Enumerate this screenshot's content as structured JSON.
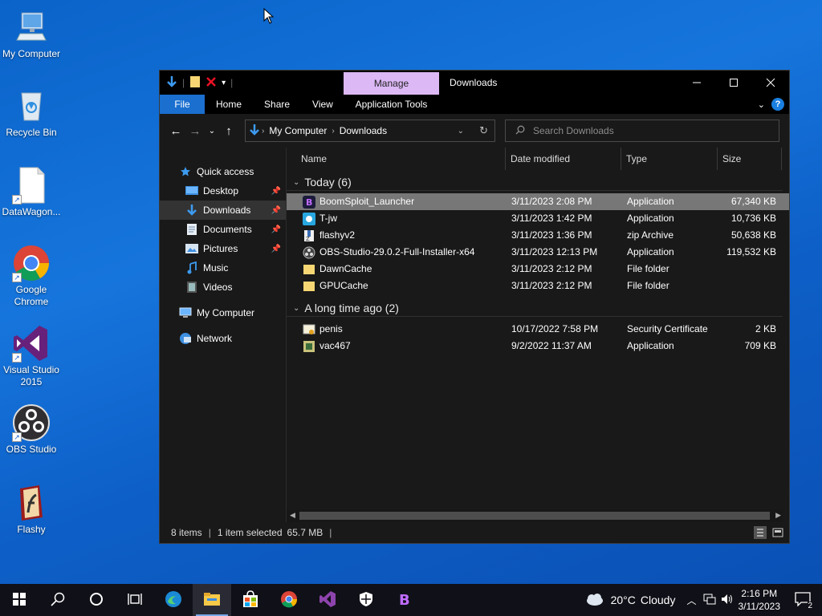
{
  "desktop": {
    "icons": [
      {
        "label": "My Computer",
        "icon": "computer-icon"
      },
      {
        "label": "Recycle Bin",
        "icon": "recycle-bin-icon"
      },
      {
        "label": "DataWagon...",
        "icon": "file-icon"
      },
      {
        "label": "Google Chrome",
        "icon": "chrome-icon"
      },
      {
        "label": "Visual Studio 2015",
        "icon": "visual-studio-icon"
      },
      {
        "label": "OBS Studio",
        "icon": "obs-icon"
      },
      {
        "label": "Flashy",
        "icon": "flashy-icon"
      }
    ]
  },
  "window": {
    "title": "Downloads",
    "manage_label": "Manage",
    "ribbon_tabs": [
      "File",
      "Home",
      "Share",
      "View"
    ],
    "app_tools_label": "Application Tools",
    "breadcrumb": [
      "My Computer",
      "Downloads"
    ],
    "search_placeholder": "Search Downloads",
    "nav": {
      "quick_access": "Quick access",
      "items": [
        {
          "label": "Desktop",
          "icon": "desktop-folder-icon",
          "pinned": true
        },
        {
          "label": "Downloads",
          "icon": "downloads-folder-icon",
          "pinned": true,
          "selected": true
        },
        {
          "label": "Documents",
          "icon": "documents-folder-icon",
          "pinned": true
        },
        {
          "label": "Pictures",
          "icon": "pictures-folder-icon",
          "pinned": true
        },
        {
          "label": "Music",
          "icon": "music-folder-icon",
          "pinned": false
        },
        {
          "label": "Videos",
          "icon": "videos-folder-icon",
          "pinned": false
        }
      ],
      "my_computer": "My Computer",
      "network": "Network"
    },
    "columns": [
      "Name",
      "Date modified",
      "Type",
      "Size"
    ],
    "groups": [
      {
        "title": "Today (6)",
        "rows": [
          {
            "name": "BoomSploit_Launcher",
            "date": "3/11/2023 2:08 PM",
            "type": "Application",
            "size": "67,340 KB",
            "icon": "boomsploit-app-icon",
            "selected": true
          },
          {
            "name": "T-jw",
            "date": "3/11/2023 1:42 PM",
            "type": "Application",
            "size": "10,736 KB",
            "icon": "tjw-app-icon"
          },
          {
            "name": "flashyv2",
            "date": "3/11/2023 1:36 PM",
            "type": "zip Archive",
            "size": "50,638 KB",
            "icon": "zip-icon"
          },
          {
            "name": "OBS-Studio-29.0.2-Full-Installer-x64",
            "date": "3/11/2023 12:13 PM",
            "type": "Application",
            "size": "119,532 KB",
            "icon": "obs-installer-icon"
          },
          {
            "name": "DawnCache",
            "date": "3/11/2023 2:12 PM",
            "type": "File folder",
            "size": "",
            "icon": "folder-icon"
          },
          {
            "name": "GPUCache",
            "date": "3/11/2023 2:12 PM",
            "type": "File folder",
            "size": "",
            "icon": "folder-icon"
          }
        ]
      },
      {
        "title": "A long time ago (2)",
        "rows": [
          {
            "name": "penis",
            "date": "10/17/2022 7:58 PM",
            "type": "Security Certificate",
            "size": "2 KB",
            "icon": "certificate-icon"
          },
          {
            "name": "vac467",
            "date": "9/2/2022 11:37 AM",
            "type": "Application",
            "size": "709 KB",
            "icon": "vac-app-icon"
          }
        ]
      }
    ],
    "status": {
      "items": "8 items",
      "selected": "1 item selected",
      "size": "65.7 MB"
    }
  },
  "taskbar": {
    "weather_temp": "20°C",
    "weather_text": "Cloudy",
    "time": "2:16 PM",
    "date": "3/11/2023",
    "notification_count": "2"
  },
  "colors": {
    "manage_tab": "#dcb8f5",
    "file_tab": "#1a6fcf",
    "selected_row": "#777777",
    "desktop_bg": "#0a63c9"
  }
}
